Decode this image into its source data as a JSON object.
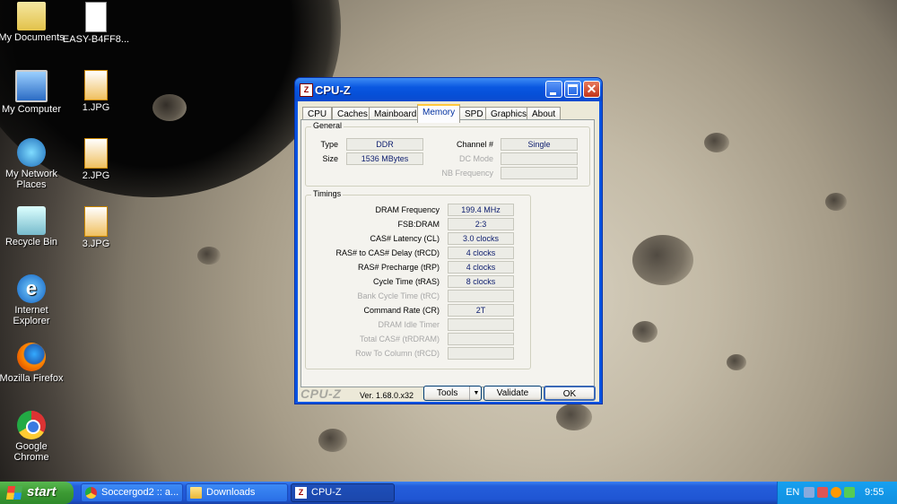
{
  "desktop": {
    "icons": [
      {
        "label": "My Documents",
        "icon": "my-documents-icon"
      },
      {
        "label": "EASY-B4FF8...",
        "icon": "text-file-icon"
      },
      {
        "label": "My Computer",
        "icon": "my-computer-icon"
      },
      {
        "label": "1.JPG",
        "icon": "jpg-file-icon"
      },
      {
        "label": "My Network Places",
        "icon": "network-places-icon"
      },
      {
        "label": "2.JPG",
        "icon": "jpg-file-icon"
      },
      {
        "label": "Recycle Bin",
        "icon": "recycle-bin-icon"
      },
      {
        "label": "3.JPG",
        "icon": "jpg-file-icon"
      },
      {
        "label": "Internet Explorer",
        "icon": "internet-explorer-icon"
      },
      {
        "label": "Mozilla Firefox",
        "icon": "firefox-icon"
      },
      {
        "label": "Google Chrome",
        "icon": "chrome-icon"
      }
    ]
  },
  "window": {
    "title": "CPU-Z",
    "app_icon_glyph": "Z",
    "tabs": [
      "CPU",
      "Caches",
      "Mainboard",
      "Memory",
      "SPD",
      "Graphics",
      "About"
    ],
    "active_tab": "Memory",
    "general": {
      "title": "General",
      "type_label": "Type",
      "type_value": "DDR",
      "size_label": "Size",
      "size_value": "1536 MBytes",
      "channel_label": "Channel #",
      "channel_value": "Single",
      "dc_mode_label": "DC Mode",
      "dc_mode_value": "",
      "nb_freq_label": "NB Frequency",
      "nb_freq_value": ""
    },
    "timings": {
      "title": "Timings",
      "rows": [
        {
          "label": "DRAM Frequency",
          "value": "199.4 MHz",
          "enabled": true
        },
        {
          "label": "FSB:DRAM",
          "value": "2:3",
          "enabled": true
        },
        {
          "label": "CAS# Latency (CL)",
          "value": "3.0 clocks",
          "enabled": true
        },
        {
          "label": "RAS# to CAS# Delay (tRCD)",
          "value": "4 clocks",
          "enabled": true
        },
        {
          "label": "RAS# Precharge (tRP)",
          "value": "4 clocks",
          "enabled": true
        },
        {
          "label": "Cycle Time (tRAS)",
          "value": "8 clocks",
          "enabled": true
        },
        {
          "label": "Bank Cycle Time (tRC)",
          "value": "",
          "enabled": false
        },
        {
          "label": "Command Rate (CR)",
          "value": "2T",
          "enabled": true
        },
        {
          "label": "DRAM Idle Timer",
          "value": "",
          "enabled": false
        },
        {
          "label": "Total CAS# (tRDRAM)",
          "value": "",
          "enabled": false
        },
        {
          "label": "Row To Column (tRCD)",
          "value": "",
          "enabled": false
        }
      ]
    },
    "footer": {
      "brand": "CPU-Z",
      "version": "Ver. 1.68.0.x32",
      "tools_label": "Tools",
      "tools_arrow": "▼",
      "validate_label": "Validate",
      "ok_label": "OK"
    }
  },
  "taskbar": {
    "start_label": "start",
    "tasks": [
      {
        "label": "Soccergod2 :: a...",
        "icon": "chrome-icon"
      },
      {
        "label": "Downloads",
        "icon": "folder-icon"
      },
      {
        "label": "CPU-Z",
        "icon": "cpuz-icon",
        "active": true
      }
    ],
    "language": "EN",
    "clock": "9:55"
  }
}
